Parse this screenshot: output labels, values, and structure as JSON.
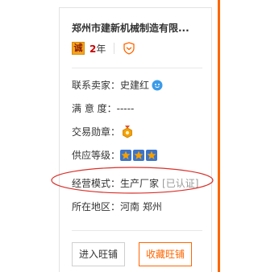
{
  "shop": {
    "name": "郑州市建新机械制造有限...",
    "cert_badge": "诚",
    "years_num": "2",
    "years_unit": "年"
  },
  "info": {
    "contact_label": "联系卖家：",
    "contact_value": "史建红",
    "satisfaction_label": "满 意 度：",
    "satisfaction_value": "-----",
    "medal_label": "交易勋章：",
    "supply_label": "供应等级：",
    "supply_stars": 3,
    "mode_label": "经营模式：",
    "mode_value": "生产厂家",
    "mode_certified": "[已认证]",
    "region_label": "所在地区：",
    "region_value": "河南 郑州"
  },
  "buttons": {
    "enter_shop": "进入旺铺",
    "favorite_shop": "收藏旺铺"
  },
  "colors": {
    "accent": "#ff6600",
    "annotation": "#d9302a",
    "star": "#f5a000",
    "chat": "#3a9be8"
  },
  "icons": [
    "shield-icon",
    "chat-icon",
    "medal-icon",
    "star-icon"
  ]
}
